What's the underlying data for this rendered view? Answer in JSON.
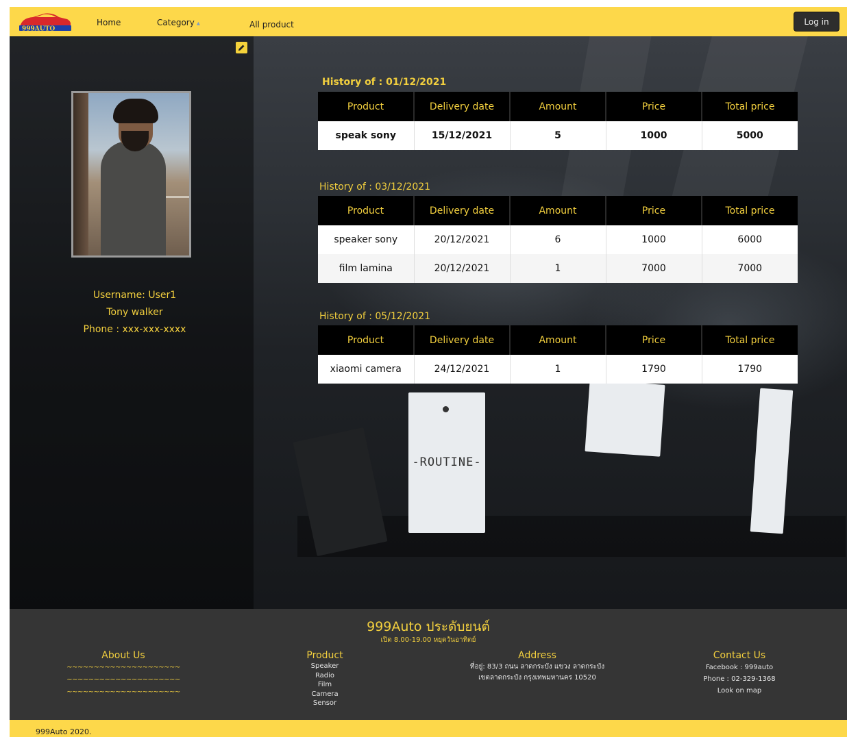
{
  "nav": {
    "logo_text": "999AUTO",
    "home": "Home",
    "category": "Category",
    "all_product": "All product",
    "login": "Log in"
  },
  "profile": {
    "username": "Username: User1",
    "name": "Tony walker",
    "phone": "Phone : xxx-xxx-xxxx"
  },
  "table_headers": [
    "Product",
    "Delivery date",
    "Amount",
    "Price",
    "Total price"
  ],
  "histories": [
    {
      "title": "History of : 01/12/2021",
      "rows": [
        [
          "speak sony",
          "15/12/2021",
          "5",
          "1000",
          "5000"
        ]
      ]
    },
    {
      "title": "History of : 03/12/2021",
      "rows": [
        [
          "speaker sony",
          "20/12/2021",
          "6",
          "1000",
          "6000"
        ],
        [
          "film lamina",
          "20/12/2021",
          "1",
          "7000",
          "7000"
        ]
      ]
    },
    {
      "title": "History of : 05/12/2021",
      "rows": [
        [
          "xiaomi camera",
          "24/12/2021",
          "1",
          "1790",
          "1790"
        ]
      ]
    }
  ],
  "background_tag_text": "-ROUTINE-",
  "footer": {
    "brand": "999Auto ประดับยนต์",
    "hours": "เปิด 8.00-19.00 หยุดวันอาทิตย์",
    "about": {
      "title": "About Us",
      "lines": [
        "~~~~~~~~~~~~~~~~~~~~~",
        "~~~~~~~~~~~~~~~~~~~~~",
        "~~~~~~~~~~~~~~~~~~~~~"
      ]
    },
    "product": {
      "title": "Product",
      "items": [
        "Speaker",
        "Radio",
        "Film",
        "Camera",
        "Sensor"
      ]
    },
    "address": {
      "title": "Address",
      "lines": [
        "ที่อยู่: 83/3 ถนน ลาดกระบัง แขวง ลาดกระบัง",
        "เขตลาดกระบัง กรุงเทพมหานคร 10520"
      ]
    },
    "contact": {
      "title": "Contact Us",
      "lines": [
        "Facebook : 999auto",
        "Phone : 02-329-1368",
        "Look on map"
      ]
    },
    "copyright": "999Auto 2020."
  },
  "colors": {
    "nav_bg": "#fdd84a",
    "accent_text": "#f2cf3e",
    "footer_bg": "#353535",
    "table_header_bg": "#000000"
  }
}
